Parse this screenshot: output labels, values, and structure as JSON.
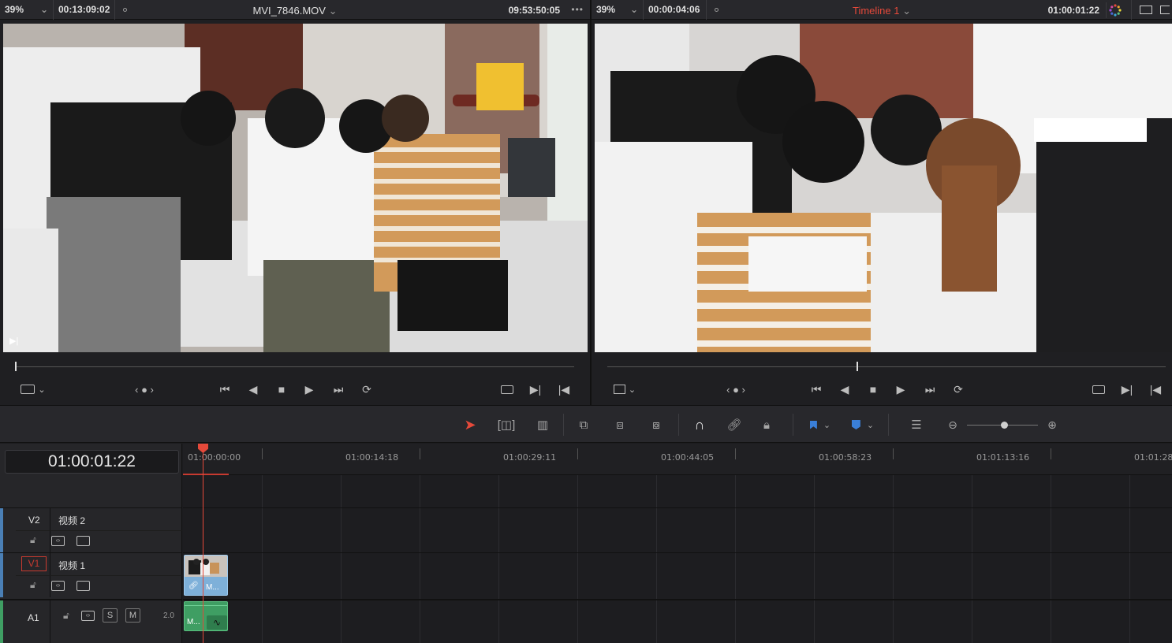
{
  "source_viewer": {
    "zoom": "39%",
    "timecode_left": "00:13:09:02",
    "clip_name": "MVI_7846.MOV",
    "timecode_right": "09:53:50:05",
    "more": "•••"
  },
  "timeline_viewer": {
    "zoom": "39%",
    "timecode_left": "00:00:04:06",
    "timeline_name": "Timeline 1",
    "timecode_right": "01:00:01:22"
  },
  "nav_dots": "‹ ● ›",
  "timeline": {
    "current_timecode": "01:00:01:22",
    "ruler_labels": [
      "01:00:00:00",
      "01:00:14:18",
      "01:00:29:11",
      "01:00:44:05",
      "01:00:58:23",
      "01:01:13:16",
      "01:01:28:"
    ],
    "tracks": [
      {
        "id": "V2",
        "name": "视频 2"
      },
      {
        "id": "V1",
        "name": "视频 1"
      },
      {
        "id": "A1",
        "name": "",
        "channels": "2.0"
      }
    ],
    "solo_label": "S",
    "mute_label": "M",
    "video_clip_label": "M...",
    "audio_clip_label": "M..."
  },
  "colors": {
    "accent_red": "#e5493a",
    "video_clip": "#7eb0d9",
    "audio_clip": "#3f9e63",
    "track_stripe_video": "#4a7fb5",
    "track_stripe_audio": "#3f9e63"
  }
}
